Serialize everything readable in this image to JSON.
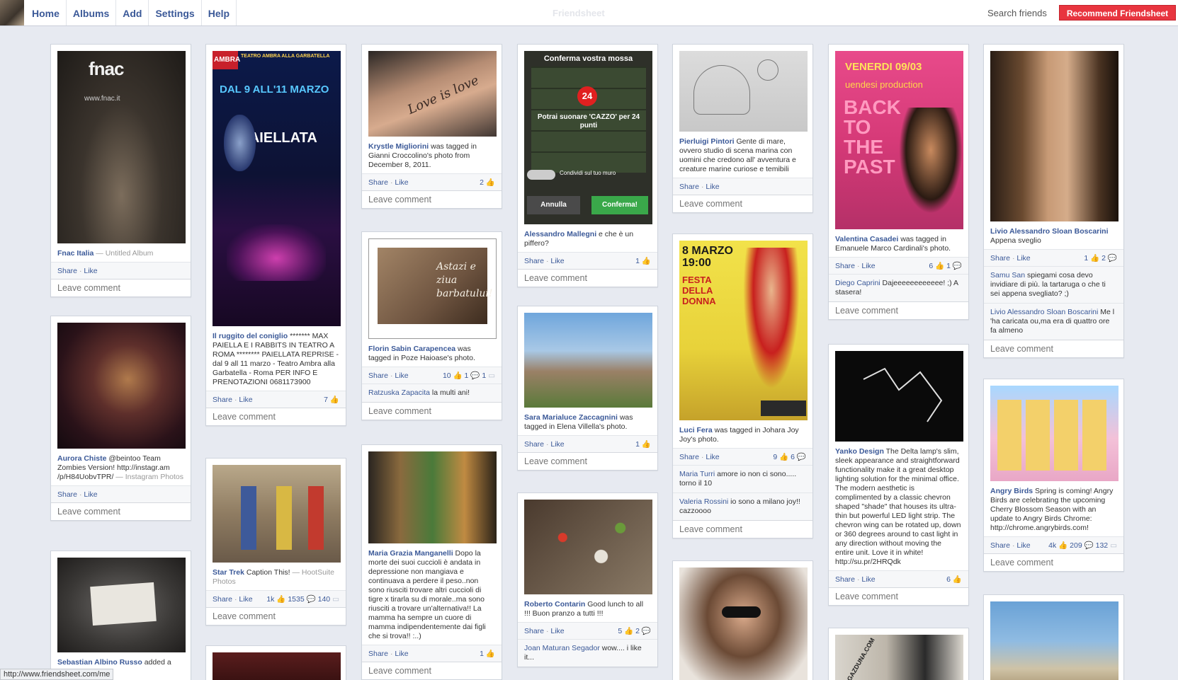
{
  "nav": [
    "Home",
    "Albums",
    "Add",
    "Settings",
    "Help"
  ],
  "brand": "Friendsheet",
  "search_label": "Search friends",
  "recommend_label": "Recommend Friendsheet",
  "leave_comment": "Leave comment",
  "share": "Share",
  "like": "Like",
  "status_url": "http://www.friendsheet.com/me",
  "posts": {
    "fnac": {
      "author": "Fnac Italia",
      "source": "— Untitled Album",
      "img_text": "fnac",
      "img_sub": "www.fnac.it"
    },
    "aurora": {
      "author": "Aurora Chiste",
      "text": "@beintoo Team Zombies Version! http://instagr.am /p/H84UobvTPR/",
      "source": "— Instagram Photos"
    },
    "bottom1": {
      "author": "Sebastian Albino Russo",
      "text": "added a"
    },
    "coniglio": {
      "author": "Il ruggito del coniglio",
      "text": "******* MAX PAIELLA E I RABBITS IN TEATRO A ROMA ******** PAIELLATA REPRISE - dal 9 all 11 marzo - Teatro Ambra alla Garbatella - Roma PER INFO E PRENOTAZIONI 0681173900",
      "likes": "7",
      "poster_title": "PAIELLATA",
      "poster_dates": "DAL 9 ALL'11 MARZO",
      "poster_head": "TEATRO AMBRA ALLA GARBATELLA",
      "poster_logo": "AMBRA"
    },
    "startrek": {
      "author": "Star Trek",
      "text": "Caption This!",
      "source": "— HootSuite Photos",
      "likes": "1k",
      "comments": "1535",
      "shares": "140"
    },
    "krystle": {
      "author": "Krystle Migliorini",
      "text": "was tagged in Gianni Croccolino's photo from December 8, 2011.",
      "likes": "2",
      "tattoo": "Love is love"
    },
    "florin": {
      "author": "Florin Sabin Carapencea",
      "text": "was tagged in Poze Haioase's photo.",
      "likes": "10",
      "c1": "1",
      "c2": "1",
      "comment_author": "Ratzuska Zapacita",
      "comment_text": "la multi ani!",
      "img_text": "Astazi e ziua barbatului!"
    },
    "maria": {
      "author": "Maria Grazia Manganelli",
      "text": "Dopo la morte dei suoi cuccioli è andata in depressione non mangiava e continuava a perdere il peso..non sono riusciti trovare altri cuccioli di tigre x tirarla su di morale..ma sono riusciti a trovare un'alternativa!! La mamma ha sempre un cuore di mamma indipendentemente dai figli che si trova!! :..)",
      "likes": "1"
    },
    "alessandro": {
      "author": "Alessandro Mallegni",
      "text": "e che è un piffero?",
      "likes": "1",
      "game_title": "Conferma vostra mossa",
      "game_points": "24",
      "game_msg": "Potrai suonare 'CAZZO' per 24 punti",
      "game_share": "Condividi sul tuo muro",
      "btn_cancel": "Annulla",
      "btn_ok": "Conferma!"
    },
    "sara": {
      "author": "Sara Marialuce Zaccagnini",
      "text": "was tagged in Elena Villella's photo.",
      "likes": "1"
    },
    "roberto": {
      "author": "Roberto Contarin",
      "text": "Good lunch to all !!! Buon pranzo a tutti !!!",
      "likes": "5",
      "comments": "2",
      "comment_author": "Joan Maturan Segador",
      "comment_text": "wow.... i like it..."
    },
    "pierluigi": {
      "author": "Pierluigi Pintori",
      "text": "Gente di mare, ovvero studio di scena marina con uomini che credono all' avventura e creature marine curiose e temibili"
    },
    "luci": {
      "author": "Luci Fera",
      "text": "was tagged in Johara Joy Joy's photo.",
      "likes": "9",
      "comments": "6",
      "comment1_author": "Maria Turri",
      "comment1_text": "amore io non ci sono..... torno il 10",
      "comment2_author": "Valeria Rossini",
      "comment2_text": "io sono a milano joy!! cazzoooo",
      "poster_date": "8 MARZO 19:00",
      "poster_title": "FESTA DELLA DONNA"
    },
    "valentina": {
      "author": "Valentina Casadei",
      "text": "was tagged in Emanuele Marco Cardinali's photo.",
      "likes": "6",
      "comments": "1",
      "comment_author": "Diego Caprini",
      "comment_text": "Dajeeeeeeeeeeee! ;) A stasera!",
      "poster_top": "VENERDI 09/03",
      "poster_sub": "uendesi production",
      "poster_title": "BACK TO THE PAST"
    },
    "yanko": {
      "author": "Yanko Design",
      "text": "The Delta lamp's slim, sleek appearance and straightforward functionality make it a great desktop lighting solution for the minimal office. The modern aesthetic is complimented by a classic chevron shaped \"shade\" that houses its ultra-thin but powerful LED light strip. The chevron wing can be rotated up, down or 360 degrees around to cast light in any direction without moving the entire unit. Love it in white! http://su.pr/2HRQdk",
      "likes": "6",
      "img_text": "GAZDUNA.COM"
    },
    "livio": {
      "author": "Livio Alessandro Sloan Boscarini",
      "text": "Appena sveglio",
      "likes": "1",
      "comments": "2",
      "comment1_author": "Samu San",
      "comment1_text": "spiegami cosa devo invidiare di più. la tartaruga o che ti sei appena svegliato? ;)",
      "comment2_author": "Livio Alessandro Sloan Boscarini",
      "comment2_text": "Me l 'ha caricata ou,ma era di quattro ore fa almeno"
    },
    "angry": {
      "author": "Angry Birds",
      "text": "Spring is coming! Angry Birds are celebrating the upcoming Cherry Blossom Season with an update to Angry Birds Chrome: http://chrome.angrybirds.com!",
      "likes": "4k",
      "comments": "209",
      "shares": "132"
    }
  }
}
